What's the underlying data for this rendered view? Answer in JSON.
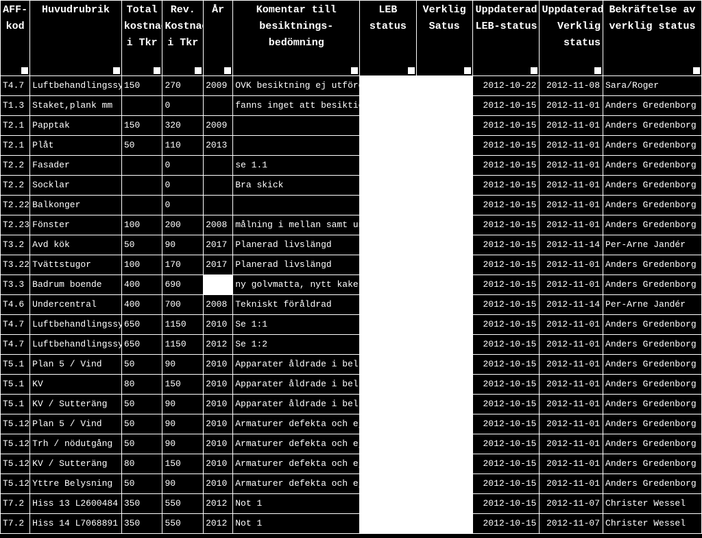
{
  "headers": [
    "AFF-kod",
    "Huvudrubrik",
    "Total kostnad i Tkr",
    "Rev. Kostnad i Tkr",
    "År",
    "Komentar till besiktnings-bedömning",
    "LEB status",
    "Verklig Satus",
    "Uppdaterad LEB-status",
    "Uppdaterad Verklig status",
    "Bekräftelse av verklig status"
  ],
  "rows": [
    {
      "aff": "T4.7",
      "rubrik": "Luftbehandlingssys",
      "total": "150",
      "rev": "270",
      "ar": "2009",
      "kom": "OVK besiktning ej utförd",
      "leb": "",
      "verk": "",
      "uleb": "2012-10-22",
      "uverk": "2012-11-08",
      "bek": "Sara/Roger",
      "arwhite": false
    },
    {
      "aff": "T1.3",
      "rubrik": "Staket,plank mm",
      "total": "",
      "rev": "0",
      "ar": "",
      "kom": "fanns inget att besiktiga",
      "leb": "",
      "verk": "",
      "uleb": "2012-10-15",
      "uverk": "2012-11-01",
      "bek": "Anders Gredenborg",
      "arwhite": false
    },
    {
      "aff": "T2.1",
      "rubrik": "Papptak",
      "total": "150",
      "rev": "320",
      "ar": "2009",
      "kom": "",
      "leb": "",
      "verk": "",
      "uleb": "2012-10-15",
      "uverk": "2012-11-01",
      "bek": "Anders Gredenborg",
      "arwhite": false
    },
    {
      "aff": "T2.1",
      "rubrik": "Plåt",
      "total": "50",
      "rev": "110",
      "ar": "2013",
      "kom": "",
      "leb": "",
      "verk": "",
      "uleb": "2012-10-15",
      "uverk": "2012-11-01",
      "bek": "Anders Gredenborg",
      "arwhite": false
    },
    {
      "aff": "T2.2",
      "rubrik": "Fasader",
      "total": "",
      "rev": "0",
      "ar": "",
      "kom": "se 1.1",
      "leb": "",
      "verk": "",
      "uleb": "2012-10-15",
      "uverk": "2012-11-01",
      "bek": "Anders Gredenborg",
      "arwhite": false
    },
    {
      "aff": "T2.2",
      "rubrik": "Socklar",
      "total": "",
      "rev": "0",
      "ar": "",
      "kom": "Bra skick",
      "leb": "",
      "verk": "",
      "uleb": "2012-10-15",
      "uverk": "2012-11-01",
      "bek": "Anders Gredenborg",
      "arwhite": false
    },
    {
      "aff": "T2.22",
      "rubrik": "Balkonger",
      "total": "",
      "rev": "0",
      "ar": "",
      "kom": "",
      "leb": "",
      "verk": "",
      "uleb": "2012-10-15",
      "uverk": "2012-11-01",
      "bek": "Anders Gredenborg",
      "arwhite": false
    },
    {
      "aff": "T2.23",
      "rubrik": "Fönster",
      "total": "100",
      "rev": "200",
      "ar": "2008",
      "kom": "målning i mellan samt und",
      "leb": "",
      "verk": "",
      "uleb": "2012-10-15",
      "uverk": "2012-11-01",
      "bek": "Anders Gredenborg",
      "arwhite": false
    },
    {
      "aff": "T3.2",
      "rubrik": "Avd kök",
      "total": "50",
      "rev": "90",
      "ar": "2017",
      "kom": "Planerad livslängd",
      "leb": "",
      "verk": "",
      "uleb": "2012-10-15",
      "uverk": "2012-11-14",
      "bek": "Per-Arne Jandér",
      "arwhite": false
    },
    {
      "aff": "T3.22",
      "rubrik": "Tvättstugor",
      "total": "100",
      "rev": "170",
      "ar": "2017",
      "kom": "Planerad livslängd",
      "leb": "",
      "verk": "",
      "uleb": "2012-10-15",
      "uverk": "2012-11-01",
      "bek": "Anders Gredenborg",
      "arwhite": false
    },
    {
      "aff": "T3.3",
      "rubrik": "Badrum boende",
      "total": "400",
      "rev": "690",
      "ar": "",
      "kom": "ny golvmatta, nytt kakel",
      "leb": "",
      "verk": "",
      "uleb": "2012-10-15",
      "uverk": "2012-11-01",
      "bek": "Anders Gredenborg",
      "arwhite": true
    },
    {
      "aff": "T4.6",
      "rubrik": "Undercentral",
      "total": "400",
      "rev": "700",
      "ar": "2008",
      "kom": "Tekniskt föråldrad",
      "leb": "",
      "verk": "",
      "uleb": "2012-10-15",
      "uverk": "2012-11-14",
      "bek": "Per-Arne Jandér",
      "arwhite": false
    },
    {
      "aff": "T4.7",
      "rubrik": "Luftbehandlingssys",
      "total": "650",
      "rev": "1150",
      "ar": "2010",
      "kom": "Se 1:1",
      "leb": "",
      "verk": "",
      "uleb": "2012-10-15",
      "uverk": "2012-11-01",
      "bek": "Anders Gredenborg",
      "arwhite": false
    },
    {
      "aff": "T4.7",
      "rubrik": "Luftbehandlingssys",
      "total": "650",
      "rev": "1150",
      "ar": "2012",
      "kom": "Se 1:2",
      "leb": "",
      "verk": "",
      "uleb": "2012-10-15",
      "uverk": "2012-11-01",
      "bek": "Anders Gredenborg",
      "arwhite": false
    },
    {
      "aff": "T5.1",
      "rubrik": "Plan 5 /   Vind",
      "total": "50",
      "rev": "90",
      "ar": "2010",
      "kom": "Apparater åldrade i bel.",
      "leb": "",
      "verk": "",
      "uleb": "2012-10-15",
      "uverk": "2012-11-01",
      "bek": "Anders Gredenborg",
      "arwhite": false
    },
    {
      "aff": "T5.1",
      "rubrik": "KV",
      "total": "80",
      "rev": "150",
      "ar": "2010",
      "kom": "Apparater åldrade i bel.",
      "leb": "",
      "verk": "",
      "uleb": "2012-10-15",
      "uverk": "2012-11-01",
      "bek": "Anders Gredenborg",
      "arwhite": false
    },
    {
      "aff": "T5.1",
      "rubrik": "KV / Sutteräng",
      "total": "50",
      "rev": "90",
      "ar": "2010",
      "kom": "Apparater åldrade i bel.",
      "leb": "",
      "verk": "",
      "uleb": "2012-10-15",
      "uverk": "2012-11-01",
      "bek": "Anders Gredenborg",
      "arwhite": false
    },
    {
      "aff": "T5.12",
      "rubrik": "Plan 5 /   Vind",
      "total": "50",
      "rev": "90",
      "ar": "2010",
      "kom": "Armaturer defekta och ej",
      "leb": "",
      "verk": "",
      "uleb": "2012-10-15",
      "uverk": "2012-11-01",
      "bek": "Anders Gredenborg",
      "arwhite": false
    },
    {
      "aff": "T5.12",
      "rubrik": "Trh / nödutgång",
      "total": "50",
      "rev": "90",
      "ar": "2010",
      "kom": "Armaturer defekta och ej",
      "leb": "",
      "verk": "",
      "uleb": "2012-10-15",
      "uverk": "2012-11-01",
      "bek": "Anders Gredenborg",
      "arwhite": false
    },
    {
      "aff": "T5.12",
      "rubrik": "KV / Sutteräng",
      "total": "80",
      "rev": "150",
      "ar": "2010",
      "kom": "Armaturer defekta och ej",
      "leb": "",
      "verk": "",
      "uleb": "2012-10-15",
      "uverk": "2012-11-01",
      "bek": "Anders Gredenborg",
      "arwhite": false
    },
    {
      "aff": "T5.12",
      "rubrik": "Yttre Belysning",
      "total": "50",
      "rev": "90",
      "ar": "2010",
      "kom": "Armaturer defekta och ej",
      "leb": "",
      "verk": "",
      "uleb": "2012-10-15",
      "uverk": "2012-11-01",
      "bek": "Anders Gredenborg",
      "arwhite": false
    },
    {
      "aff": "T7.2",
      "rubrik": "Hiss 13 L2600484",
      "total": "350",
      "rev": "550",
      "ar": "2012",
      "kom": "Not 1",
      "leb": "",
      "verk": "",
      "uleb": "2012-10-15",
      "uverk": "2012-11-07",
      "bek": "Christer Wessel",
      "arwhite": false
    },
    {
      "aff": "T7.2",
      "rubrik": "Hiss 14 L7068891",
      "total": "350",
      "rev": "550",
      "ar": "2012",
      "kom": "Not 1",
      "leb": "",
      "verk": "",
      "uleb": "2012-10-15",
      "uverk": "2012-11-07",
      "bek": "Christer Wessel",
      "arwhite": false
    }
  ]
}
